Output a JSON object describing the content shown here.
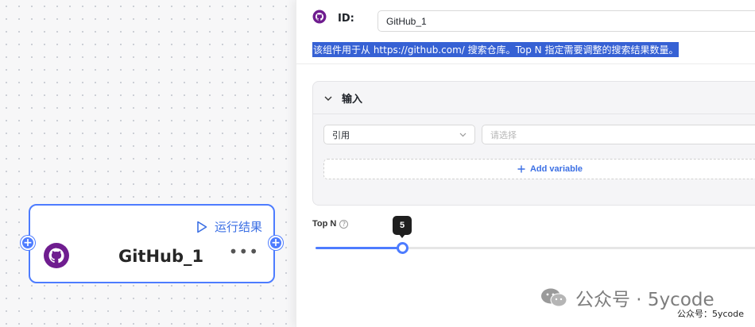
{
  "node": {
    "run_label": "运行结果",
    "title": "GitHub_1",
    "more": "•••"
  },
  "panel": {
    "id_label": "ID:",
    "id_value": "GitHub_1",
    "description": "该组件用于从 https://github.com/ 搜索仓库。Top N 指定需要调整的搜索结果数量。",
    "input_section": {
      "title": "输入",
      "select_value": "引用",
      "select_placeholder": "请选择",
      "add_variable": "Add variable"
    },
    "top_n": {
      "label": "Top N",
      "value": "5",
      "slider_fraction": 0.195
    }
  },
  "watermark": {
    "big": "公众号 · 5ycode",
    "small": "公众号：5ycode"
  },
  "colors": {
    "accent": "#4d7cff",
    "github_purple": "#6f1d8f",
    "selection": "#3661d4"
  }
}
